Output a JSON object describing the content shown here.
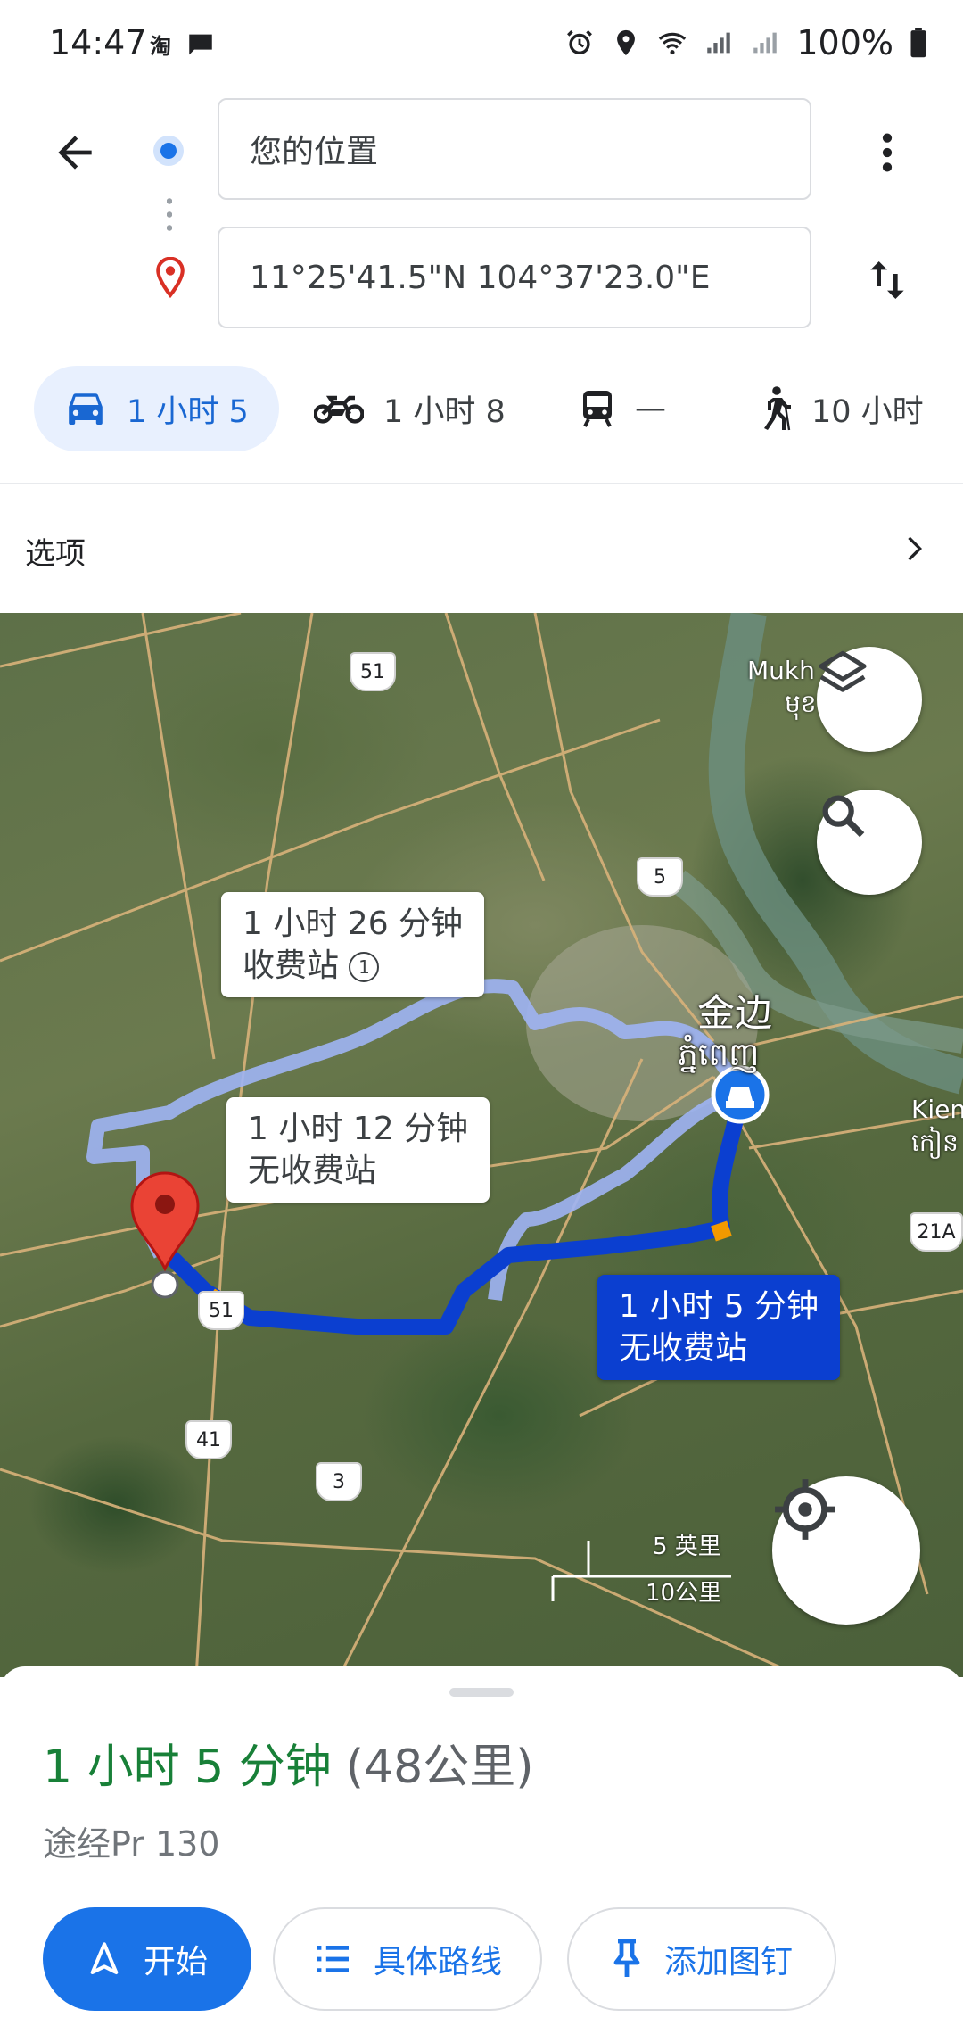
{
  "status_bar": {
    "time": "14:47",
    "left_icons": [
      "taobao-icon",
      "message-icon"
    ],
    "right_icons": [
      "alarm-icon",
      "location-icon",
      "wifi-icon",
      "signal-icon",
      "signal-icon",
      "battery-icon"
    ],
    "battery": "100%"
  },
  "directions": {
    "origin": "您的位置",
    "destination": "11°25'41.5\"N 104°37'23.0\"E"
  },
  "modes": [
    {
      "icon": "car-icon",
      "label": "1 小时 5",
      "active": true
    },
    {
      "icon": "motorcycle-icon",
      "label": "1 小时 8",
      "active": false
    },
    {
      "icon": "transit-icon",
      "label": "—",
      "active": false
    },
    {
      "icon": "walk-icon",
      "label": "10 小时",
      "active": false
    }
  ],
  "options": {
    "label": "选项"
  },
  "map": {
    "routes": [
      {
        "line1": "1 小时 26 分钟",
        "line2": "收费站"
      },
      {
        "line1": "1 小时 12 分钟",
        "line2": "无收费站"
      },
      {
        "line1": "1 小时 5 分钟",
        "line2": "无收费站",
        "selected": true
      }
    ],
    "places": {
      "city_cn": "金边",
      "city_km": "ភ្នំពេញ",
      "mukh": "Mukh",
      "mukh_km": "មុខ",
      "kien": "Kien",
      "kien_km": "កៀន"
    },
    "road_shields": [
      "51",
      "5",
      "51",
      "41",
      "3",
      "21A"
    ],
    "scale": {
      "imperial": "5 英里",
      "metric": "10公里"
    }
  },
  "summary": {
    "duration": "1 小时 5 分钟",
    "distance": "(48公里)",
    "via": "途经Pr 130"
  },
  "actions": {
    "start": "开始",
    "steps": "具体路线",
    "pin": "添加图钉"
  },
  "colors": {
    "accent": "#1a73e8",
    "duration_green": "#188038",
    "route_selected": "#0b3fd0",
    "route_alt": "#9fb4f4"
  }
}
